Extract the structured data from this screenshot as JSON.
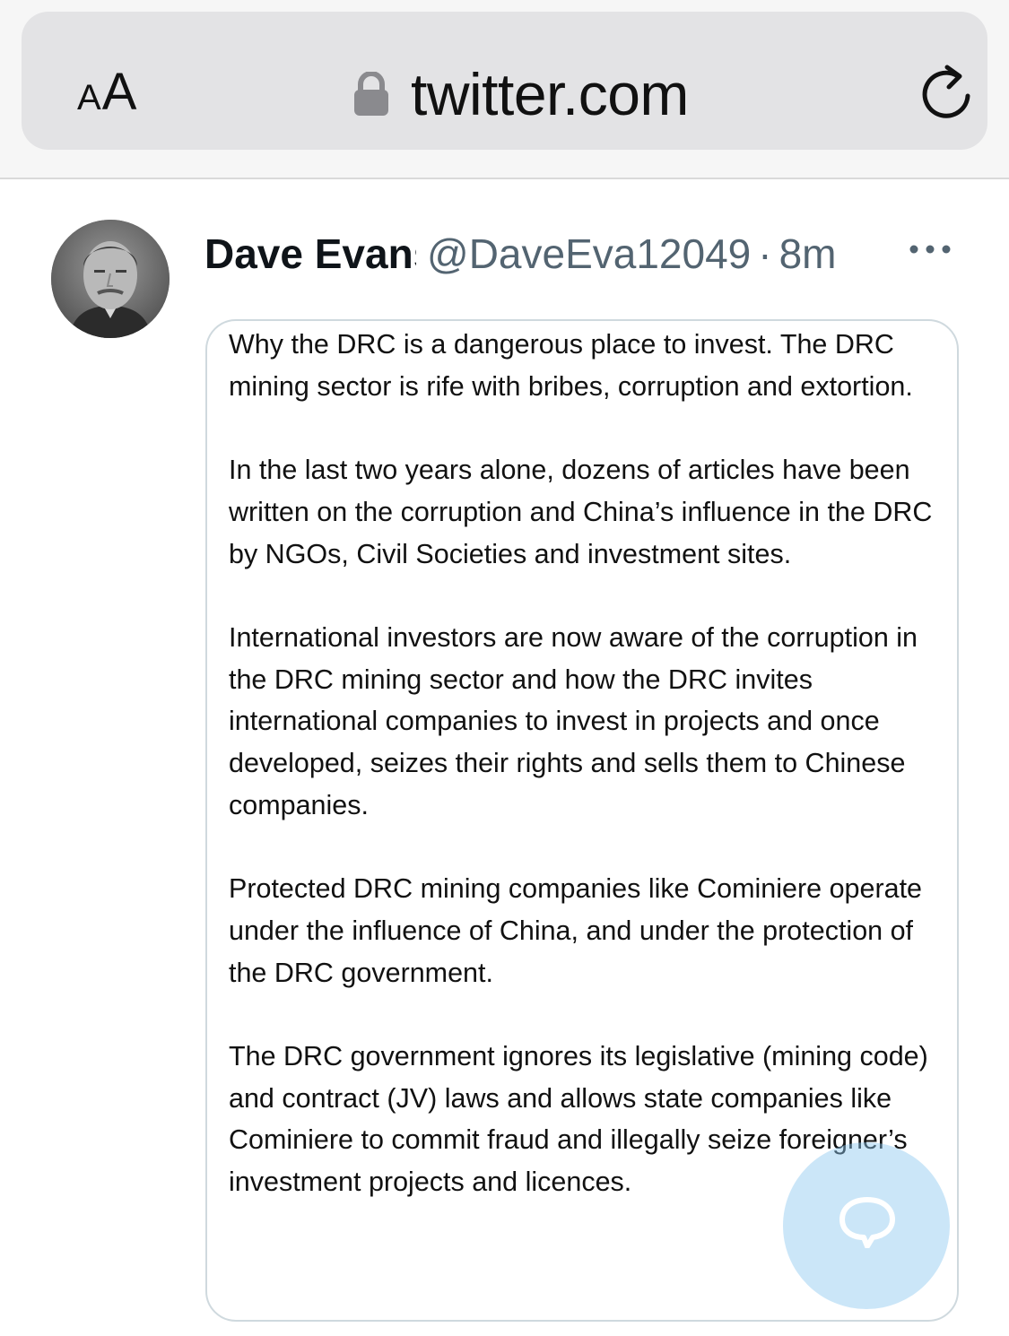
{
  "browser": {
    "text_size_label_small": "A",
    "text_size_label_large": "A",
    "url": "twitter.com",
    "accent_color": "#1d9bf0"
  },
  "tweet": {
    "display_name": "Dave Evans",
    "handle": "@DaveEva12049",
    "separator": "·",
    "time": "8m",
    "image_text": [
      "Why the DRC is a dangerous place to invest. The DRC mining sector is rife with bribes, corruption and extortion.",
      "In the last two years alone, dozens of articles have been written on the corruption and China’s influence in the DRC by NGOs, Civil Societies and investment sites.",
      "International investors are now aware of the corruption in the DRC mining sector and how the DRC invites international companies to invest in projects and once developed, seizes their rights and sells them to Chinese companies.",
      "Protected DRC mining companies like Cominiere operate under the influence of China, and under the protection of the DRC government.",
      "The DRC government ignores its legislative (mining code) and contract (JV) laws and allows state companies like Cominiere to commit fraud and illegally seize foreigner’s investment projects and licences."
    ]
  },
  "icons": {
    "lock": "lock-icon",
    "reload": "reload-icon",
    "more": "more-icon",
    "compose": "compose-icon"
  }
}
